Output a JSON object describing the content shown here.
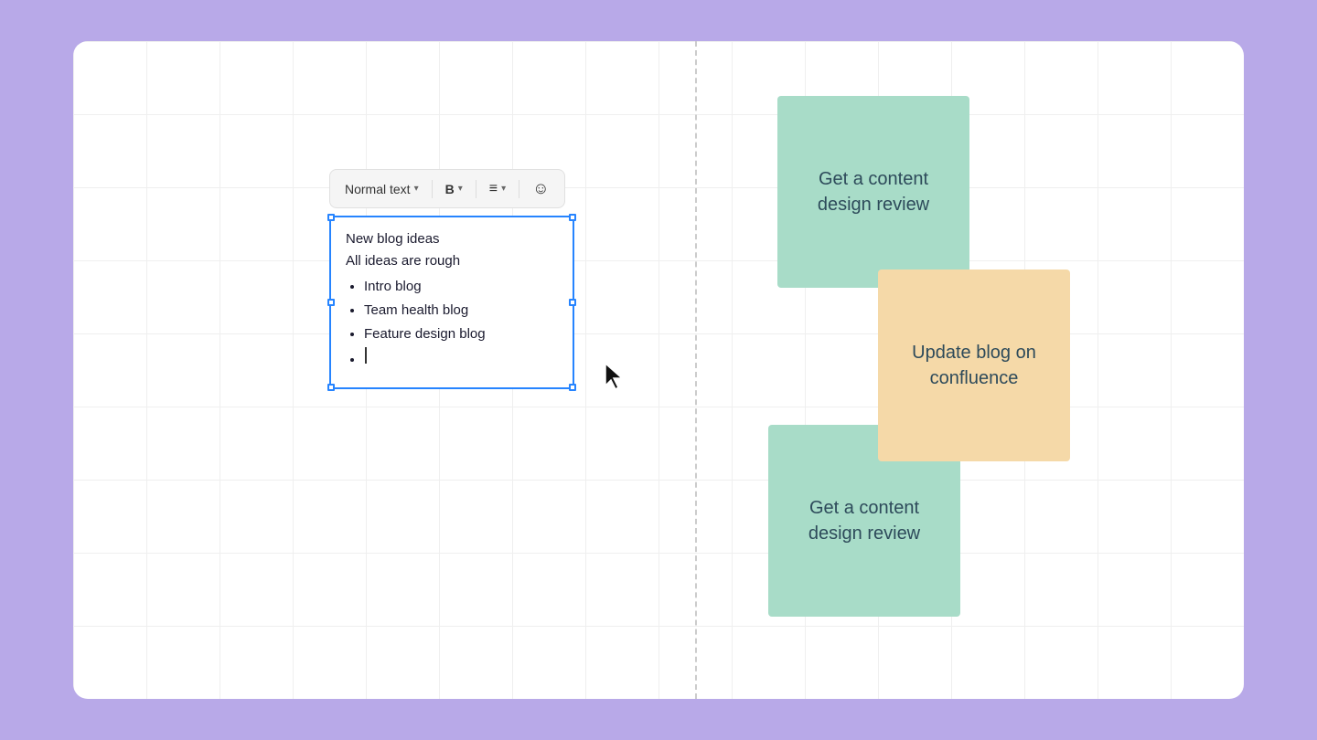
{
  "canvas": {
    "background": "#ffffff",
    "accent_color": "#b8a9e8"
  },
  "toolbar": {
    "text_style_label": "Normal text",
    "text_style_chevron": "▾",
    "bold_label": "B",
    "bold_chevron": "▾",
    "list_chevron": "▾",
    "emoji_label": "☺"
  },
  "editor": {
    "line1": "New blog ideas",
    "line2": "All ideas are rough",
    "bullet1": "Intro blog",
    "bullet2": "Team health blog",
    "bullet3": "Feature design blog",
    "bullet4_placeholder": ""
  },
  "sticky_notes": [
    {
      "id": "note-1",
      "text": "Get a content design review",
      "color": "#a8dcc8",
      "position": "top-right"
    },
    {
      "id": "note-2",
      "text": "Update blog on confluence",
      "color": "#f5d9a8",
      "position": "middle-right"
    },
    {
      "id": "note-3",
      "text": "Get a content design review",
      "color": "#a8dcc8",
      "position": "bottom-right"
    }
  ]
}
